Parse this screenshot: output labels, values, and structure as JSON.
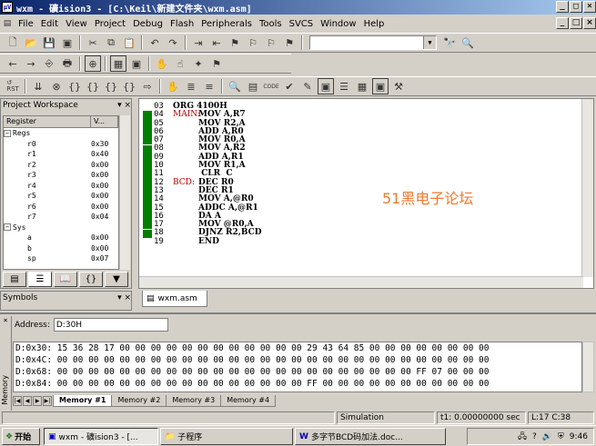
{
  "window": {
    "title": "wxm  - 礦ision3 - [C:\\Keil\\新建文件夹\\wxm.asm]",
    "app_icon": "uvision-icon"
  },
  "menu": [
    "File",
    "Edit",
    "View",
    "Project",
    "Debug",
    "Flash",
    "Peripherals",
    "Tools",
    "SVCS",
    "Window",
    "Help"
  ],
  "workspace": {
    "title": "Project Workspace",
    "columns": [
      "Register",
      "V..."
    ],
    "groups": [
      {
        "name": "Regs",
        "rows": [
          {
            "name": "r0",
            "value": "0x30"
          },
          {
            "name": "r1",
            "value": "0x40"
          },
          {
            "name": "r2",
            "value": "0x00"
          },
          {
            "name": "r3",
            "value": "0x00"
          },
          {
            "name": "r4",
            "value": "0x00"
          },
          {
            "name": "r5",
            "value": "0x00"
          },
          {
            "name": "r6",
            "value": "0x00"
          },
          {
            "name": "r7",
            "value": "0x04"
          }
        ]
      },
      {
        "name": "Sys",
        "rows": [
          {
            "name": "a",
            "value": "0x00"
          },
          {
            "name": "b",
            "value": "0x00"
          },
          {
            "name": "sp",
            "value": "0x07"
          }
        ]
      }
    ]
  },
  "symbols": {
    "title": "Symbols"
  },
  "editor": {
    "tab_label": "wxm.asm",
    "lines": [
      {
        "no": "03",
        "label": "",
        "code": "ORG 4100H"
      },
      {
        "no": "04",
        "label": "MAIN:",
        "code": "MOV A,R7"
      },
      {
        "no": "05",
        "label": "",
        "code": "MOV R2,A"
      },
      {
        "no": "06",
        "label": "",
        "code": "ADD A,R0"
      },
      {
        "no": "07",
        "label": "",
        "code": "MOV R0,A"
      },
      {
        "no": "08",
        "label": "",
        "code": "MOV A,R2"
      },
      {
        "no": "09",
        "label": "",
        "code": "ADD A,R1"
      },
      {
        "no": "10",
        "label": "",
        "code": "MOV R1,A"
      },
      {
        "no": "11",
        "label": "",
        "code": " CLR  C"
      },
      {
        "no": "12",
        "label": "BCD:",
        "code": "DEC R0"
      },
      {
        "no": "13",
        "label": "",
        "code": "DEC R1"
      },
      {
        "no": "14",
        "label": "",
        "code": "MOV A,@R0"
      },
      {
        "no": "15",
        "label": "",
        "code": "ADDC A,@R1"
      },
      {
        "no": "16",
        "label": "",
        "code": "DA A"
      },
      {
        "no": "17",
        "label": "",
        "code": "MOV @R0,A"
      },
      {
        "no": "18",
        "label": "",
        "code": "DJNZ R2,BCD"
      },
      {
        "no": "19",
        "label": "",
        "code": "END"
      }
    ],
    "watermark": "51黑电子论坛"
  },
  "memory": {
    "address_label": "Address:",
    "address_value": "D:30H",
    "rows": [
      "D:0x30: 15 36 28 17 00 00 00 00 00 00 00 00 00 00 00 00 29 43 64 85 00 00 00 00 00 00 00 00",
      "D:0x4C: 00 00 00 00 00 00 00 00 00 00 00 00 00 00 00 00 00 00 00 00 00 00 00 00 00 00 00 00",
      "D:0x68: 00 00 00 00 00 00 00 00 00 00 00 00 00 00 00 00 00 00 00 00 00 00 00 FF 07 00 00 00",
      "D:0x84: 00 00 00 00 00 00 00 00 00 00 00 00 00 00 00 00 FF 00 00 00 00 00 00 00 00 00 00 00"
    ],
    "tabs": [
      "Memory #1",
      "Memory #2",
      "Memory #3",
      "Memory #4"
    ],
    "sidebar_label": "Memory"
  },
  "status": {
    "mode": "Simulation",
    "time": "t1: 0.00000000 sec",
    "pos": "L:17 C:38"
  },
  "taskbar": {
    "start": "开始",
    "items": [
      "wxm  - 礦ision3 - [...",
      "子程序",
      "多字节BCD码加法.doc..."
    ],
    "clock": "9:46"
  }
}
